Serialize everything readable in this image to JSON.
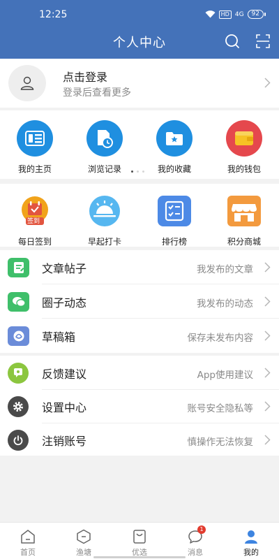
{
  "status_bar": {
    "time": "12:25",
    "hd": "HD",
    "signal": "4G",
    "battery": "92"
  },
  "header": {
    "title": "个人中心",
    "icons": [
      "search-icon",
      "scan-icon"
    ]
  },
  "login": {
    "title": "点击登录",
    "subtitle": "登录后查看更多"
  },
  "shortcuts": [
    {
      "label": "我的主页",
      "icon": "homepage-icon",
      "color": "#1f8fe0"
    },
    {
      "label": "浏览记录",
      "icon": "history-icon",
      "color": "#1f8fe0"
    },
    {
      "label": "我的收藏",
      "icon": "favorites-icon",
      "color": "#1f8fe0"
    },
    {
      "label": "我的钱包",
      "icon": "wallet-icon",
      "color": "#e5484d"
    }
  ],
  "features": [
    {
      "label": "每日签到",
      "icon": "checkin-icon",
      "badge": "签到",
      "color": "#f1a31b"
    },
    {
      "label": "早起打卡",
      "icon": "sunrise-icon",
      "color": "#56b7f0"
    },
    {
      "label": "排行榜",
      "icon": "ranking-icon",
      "color": "#4d8ae6"
    },
    {
      "label": "积分商城",
      "icon": "store-icon",
      "color": "#f39a3e"
    }
  ],
  "content_list": [
    {
      "label": "文章帖子",
      "hint": "我发布的文章",
      "icon": "article-icon",
      "color": "#3fbf6a"
    },
    {
      "label": "圈子动态",
      "hint": "我发布的动态",
      "icon": "chat-icon",
      "color": "#3fbf6a"
    },
    {
      "label": "草稿箱",
      "hint": "保存未发布内容",
      "icon": "drafts-icon",
      "color": "#6b8cd9"
    }
  ],
  "settings_list": [
    {
      "label": "反馈建议",
      "hint": "App使用建议",
      "icon": "feedback-icon",
      "color": "#8cc63f"
    },
    {
      "label": "设置中心",
      "hint": "账号安全隐私等",
      "icon": "settings-icon",
      "color": "#4a4a4a"
    },
    {
      "label": "注销账号",
      "hint": "慎操作无法恢复",
      "icon": "power-icon",
      "color": "#4a4a4a"
    }
  ],
  "bottom_nav": [
    {
      "label": "首页",
      "icon": "home-icon"
    },
    {
      "label": "渔塘",
      "icon": "pond-icon"
    },
    {
      "label": "优选",
      "icon": "shopping-bag-icon"
    },
    {
      "label": "消息",
      "icon": "message-icon",
      "badge": "1"
    },
    {
      "label": "我的",
      "icon": "profile-icon",
      "active": true
    }
  ],
  "colors": {
    "header": "#4472b9",
    "accent": "#3d84e0",
    "badge": "#e23b2e"
  }
}
